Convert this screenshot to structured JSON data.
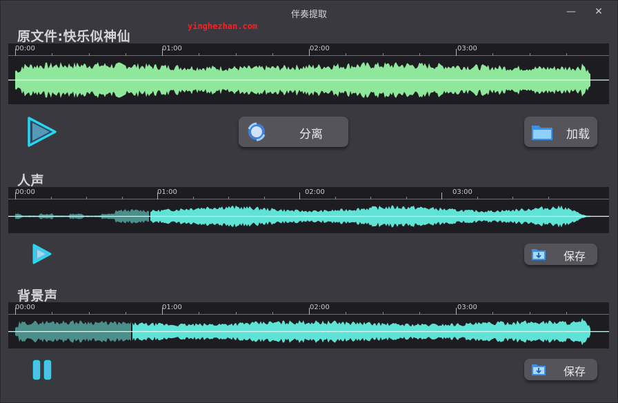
{
  "window": {
    "title": "伴奏提取",
    "minimize": "—",
    "close": "✕"
  },
  "watermark": "yinghezhan.com",
  "sections": [
    {
      "title": "原文件:快乐似神仙",
      "ticks": [
        "00:00",
        "01:00",
        "02:00",
        "03:00"
      ],
      "wave_color": "#8ee79a",
      "highlight_color": "#d8ffe0"
    },
    {
      "title": "人声",
      "ticks": [
        "00:00",
        "01:00",
        "02:00",
        "03:00"
      ],
      "wave_color": "#5ee3d6",
      "dim_color": "#4b8e8a",
      "highlight_color": "#d8fffb",
      "progress": 0.235
    },
    {
      "title": "背景声",
      "ticks": [
        "00:00",
        "01:00",
        "02:00",
        "03:00"
      ],
      "wave_color": "#5ee3d6",
      "dim_color": "#4b8e8a",
      "highlight_color": "#d8fffb",
      "progress": 0.205
    }
  ],
  "controls": {
    "separate_label": "分离",
    "load_label": "加载",
    "save_label": "保存",
    "play_icon": "play-icon",
    "pause_icon": "pause-icon",
    "accent": "#27d7f0"
  }
}
